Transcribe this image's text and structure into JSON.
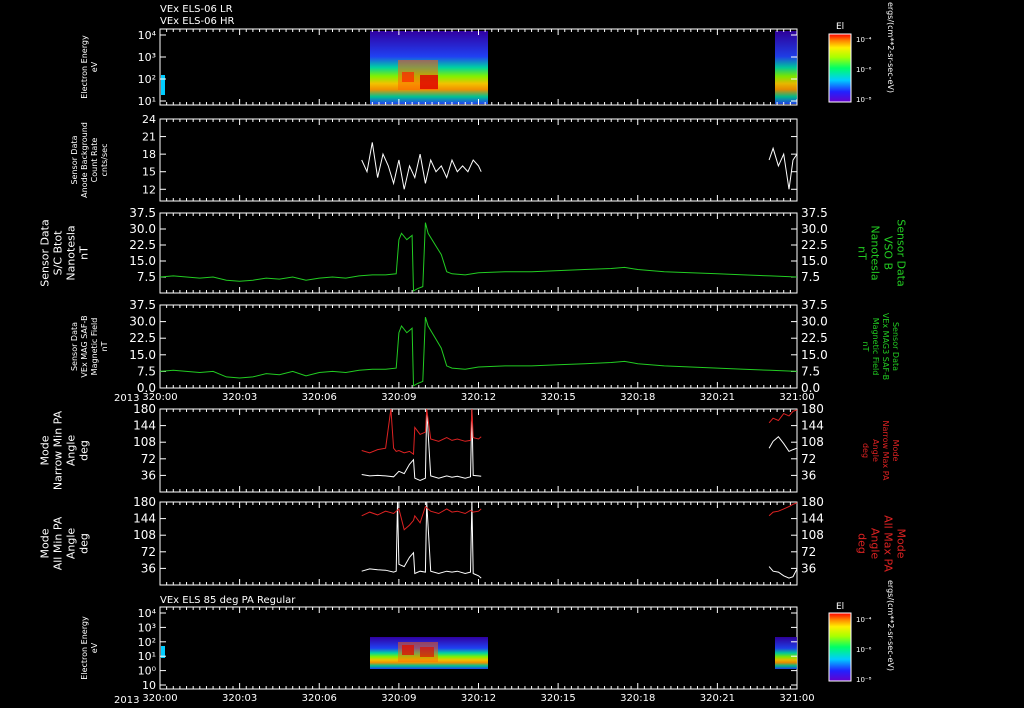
{
  "header": {
    "line1": "VEx ELS-06 LR",
    "line2": "VEx ELS-06 HR",
    "bottom_title": "VEx ELS 85 deg PA Regular",
    "year": "2013"
  },
  "colorbar": {
    "label": "El",
    "ticks": [
      "10⁻⁴",
      "10⁻⁶",
      "10⁻⁸"
    ],
    "units": "ergs/(cm**2-sr-sec-eV)"
  },
  "time_axis": {
    "ticks": [
      "320:00",
      "320:03",
      "320:06",
      "320:09",
      "320:12",
      "320:15",
      "320:18",
      "320:21",
      "321:00"
    ],
    "range": [
      0,
      24
    ]
  },
  "colors": {
    "background": "#000000",
    "line_white": "#ffffff",
    "line_green": "#22cc22",
    "line_red": "#dd2222"
  },
  "chart_data": [
    {
      "type": "heatmap",
      "title": "VEx ELS-06 HR",
      "ylabel": [
        "Electron Energy",
        "eV"
      ],
      "yticks": [
        "10⁴",
        "10³",
        "10²",
        "10¹"
      ],
      "yscale": "log",
      "x_coverage_hours": [
        [
          7.6,
          12.1
        ],
        [
          22.95,
          24.0
        ]
      ],
      "colorbar_label": "El"
    },
    {
      "type": "line",
      "ylabel": [
        "Sensor Data",
        "Anode Background",
        "Count Rate",
        "cnts/sec"
      ],
      "yticks": [
        "24",
        "21",
        "18",
        "15",
        "12"
      ],
      "ylim": [
        10,
        24
      ],
      "series": [
        {
          "color": "white",
          "x": [
            7.6,
            7.8,
            8.0,
            8.2,
            8.4,
            8.6,
            8.8,
            9.0,
            9.2,
            9.4,
            9.6,
            9.8,
            10.0,
            10.2,
            10.4,
            10.6,
            10.8,
            11.0,
            11.2,
            11.4,
            11.6,
            11.8,
            12.0,
            12.1
          ],
          "values": [
            17,
            15,
            20,
            14,
            18,
            16,
            13,
            17,
            12,
            16,
            14,
            18,
            13,
            17,
            15,
            16,
            14,
            17,
            15,
            16,
            15,
            17,
            16,
            15
          ]
        },
        {
          "color": "white",
          "x": [
            22.95,
            23.1,
            23.3,
            23.5,
            23.7,
            23.85,
            24.0
          ],
          "values": [
            17,
            19,
            16,
            18,
            12,
            17,
            18
          ]
        }
      ]
    },
    {
      "type": "line",
      "ylabel": [
        "Sensor Data",
        "S/C Btot",
        "Nanotesla",
        "nT"
      ],
      "right_label": [
        "Sensor Data",
        "VSO B",
        "Nanotesla",
        "nT"
      ],
      "yticks": [
        "37.5",
        "30.0",
        "22.5",
        "15.0",
        "7.5"
      ],
      "ylim": [
        0,
        37.5
      ],
      "series": [
        {
          "color": "green",
          "x": [
            0,
            0.5,
            1,
            1.5,
            2,
            2.5,
            3,
            3.5,
            4,
            4.5,
            5,
            5.5,
            6,
            6.5,
            7,
            7.5,
            8,
            8.5,
            8.9,
            9.0,
            9.1,
            9.3,
            9.5,
            9.55,
            9.7,
            9.9,
            10.0,
            10.1,
            10.4,
            10.6,
            10.8,
            11,
            11.5,
            12,
            13,
            14,
            15,
            16,
            17,
            17.5,
            18,
            19,
            20,
            21,
            22,
            23,
            24
          ],
          "values": [
            7.5,
            8.0,
            7.5,
            7.0,
            7.5,
            6.0,
            5.5,
            6.0,
            7.0,
            6.5,
            7.5,
            6.0,
            7.0,
            7.5,
            7.0,
            8.0,
            8.5,
            8.5,
            9.0,
            25.0,
            28.0,
            25.0,
            27.0,
            1.0,
            2.0,
            3.0,
            33.0,
            28.0,
            22.0,
            18.0,
            10.0,
            9.0,
            8.5,
            9.5,
            10.0,
            10.0,
            10.5,
            11.0,
            11.5,
            12.0,
            11.0,
            10.0,
            9.5,
            9.0,
            8.5,
            8.0,
            7.5
          ]
        }
      ]
    },
    {
      "type": "line",
      "ylabel": [
        "Sensor Data",
        "VEx MAG SAF-B",
        "Magnetic Field",
        "nT"
      ],
      "right_label": [
        "Sensor Data",
        "VEx MAG3 SAF-B",
        "Magnetic Field",
        "nT"
      ],
      "yticks": [
        "37.5",
        "30.0",
        "22.5",
        "15.0",
        "7.5",
        "0.0"
      ],
      "ylim": [
        0,
        37.5
      ],
      "series": [
        {
          "color": "green",
          "x": [
            0,
            0.5,
            1,
            1.5,
            2,
            2.5,
            3,
            3.5,
            4,
            4.5,
            5,
            5.5,
            6,
            6.5,
            7,
            7.5,
            8,
            8.5,
            8.9,
            9.0,
            9.1,
            9.3,
            9.5,
            9.55,
            9.7,
            9.9,
            10.0,
            10.1,
            10.4,
            10.6,
            10.8,
            11,
            11.5,
            12,
            13,
            14,
            15,
            16,
            17,
            17.5,
            18,
            19,
            20,
            21,
            22,
            23,
            24
          ],
          "values": [
            7.5,
            8.0,
            7.5,
            7.0,
            7.5,
            5.0,
            4.5,
            5.0,
            6.5,
            6.0,
            7.5,
            5.5,
            7.0,
            7.5,
            7.0,
            8.0,
            8.5,
            8.5,
            9.0,
            25.0,
            28.0,
            25.0,
            27.0,
            1.0,
            2.0,
            3.0,
            32.0,
            28.0,
            22.0,
            18.0,
            10.0,
            9.0,
            8.5,
            9.5,
            10.0,
            10.0,
            10.5,
            11.0,
            11.5,
            12.0,
            11.0,
            10.0,
            9.5,
            9.0,
            8.5,
            8.0,
            7.5
          ]
        }
      ]
    },
    {
      "type": "line",
      "ylabel": [
        "Mode",
        "Narrow Min PA",
        "Angle",
        "deg"
      ],
      "right_label": [
        "Mode",
        "Narrow Max PA",
        "Angle",
        "deg"
      ],
      "yticks": [
        "180",
        "144",
        "108",
        "72",
        "36"
      ],
      "ylim": [
        0,
        180
      ],
      "series": [
        {
          "color": "white",
          "x": [
            7.6,
            7.9,
            8.2,
            8.5,
            8.8,
            9.0,
            9.2,
            9.4,
            9.55,
            9.6,
            9.8,
            10.0,
            10.05,
            10.2,
            10.5,
            10.8,
            11.0,
            11.2,
            11.5,
            11.7,
            11.75,
            11.8,
            12.0,
            12.1
          ],
          "values": [
            38,
            35,
            36,
            35,
            33,
            45,
            40,
            60,
            70,
            30,
            25,
            30,
            180,
            35,
            30,
            35,
            32,
            34,
            30,
            33,
            180,
            36,
            35,
            34
          ]
        },
        {
          "color": "white",
          "x": [
            22.95,
            23.1,
            23.3,
            23.5,
            23.7,
            23.85,
            24.0
          ],
          "values": [
            95,
            110,
            120,
            105,
            88,
            92,
            95
          ]
        },
        {
          "color": "red",
          "x": [
            7.6,
            7.9,
            8.2,
            8.5,
            8.7,
            8.8,
            8.9,
            9.0,
            9.2,
            9.4,
            9.55,
            9.6,
            9.8,
            10.0,
            10.05,
            10.2,
            10.5,
            10.8,
            11.0,
            11.2,
            11.5,
            11.7,
            11.75,
            11.8,
            12.0,
            12.1
          ],
          "values": [
            90,
            85,
            92,
            95,
            180,
            95,
            88,
            90,
            85,
            88,
            82,
            140,
            125,
            130,
            180,
            115,
            110,
            118,
            112,
            115,
            110,
            112,
            180,
            118,
            115,
            120
          ]
        },
        {
          "color": "red",
          "x": [
            22.95,
            23.1,
            23.3,
            23.5,
            23.7,
            23.85,
            24.0
          ],
          "values": [
            150,
            160,
            155,
            170,
            165,
            175,
            178
          ]
        }
      ]
    },
    {
      "type": "line",
      "ylabel": [
        "Mode",
        "All Min PA",
        "Angle",
        "deg"
      ],
      "right_label": [
        "Mode",
        "All Max PA",
        "Angle",
        "deg"
      ],
      "yticks": [
        "180",
        "144",
        "108",
        "72",
        "36"
      ],
      "ylim": [
        0,
        180
      ],
      "series": [
        {
          "color": "white",
          "x": [
            7.6,
            7.9,
            8.2,
            8.5,
            8.8,
            8.9,
            8.95,
            9.0,
            9.2,
            9.4,
            9.55,
            9.6,
            9.8,
            10.0,
            10.05,
            10.2,
            10.5,
            10.8,
            11.0,
            11.2,
            11.5,
            11.7,
            11.75,
            11.8,
            12.0,
            12.1
          ],
          "values": [
            30,
            35,
            33,
            32,
            28,
            30,
            180,
            45,
            40,
            60,
            70,
            25,
            30,
            28,
            180,
            30,
            25,
            30,
            28,
            30,
            25,
            28,
            180,
            25,
            20,
            15
          ]
        },
        {
          "color": "white",
          "x": [
            22.95,
            23.1,
            23.3,
            23.5,
            23.7,
            23.85,
            24.0
          ],
          "values": [
            40,
            30,
            28,
            20,
            15,
            18,
            35
          ]
        },
        {
          "color": "red",
          "x": [
            7.6,
            7.9,
            8.2,
            8.5,
            8.8,
            9.0,
            9.2,
            9.4,
            9.55,
            9.6,
            9.8,
            10.0,
            10.2,
            10.5,
            10.8,
            11.0,
            11.2,
            11.5,
            11.7,
            11.8,
            12.0,
            12.1
          ],
          "values": [
            150,
            158,
            152,
            160,
            155,
            165,
            120,
            130,
            140,
            150,
            135,
            170,
            160,
            155,
            165,
            158,
            160,
            155,
            162,
            158,
            160,
            165
          ]
        },
        {
          "color": "red",
          "x": [
            22.95,
            23.1,
            23.3,
            23.5,
            23.7,
            23.85,
            24.0
          ],
          "values": [
            150,
            158,
            160,
            165,
            170,
            175,
            178
          ]
        }
      ]
    },
    {
      "type": "heatmap",
      "title": "VEx ELS 85 deg PA Regular",
      "ylabel": [
        "Electron Energy",
        "eV"
      ],
      "yticks": [
        "10⁴",
        "10³",
        "10²",
        "10¹",
        "10⁰",
        "10"
      ],
      "yscale": "log",
      "x_coverage_hours": [
        [
          7.6,
          12.1
        ],
        [
          22.95,
          24.0
        ]
      ],
      "colorbar_label": "El"
    }
  ]
}
